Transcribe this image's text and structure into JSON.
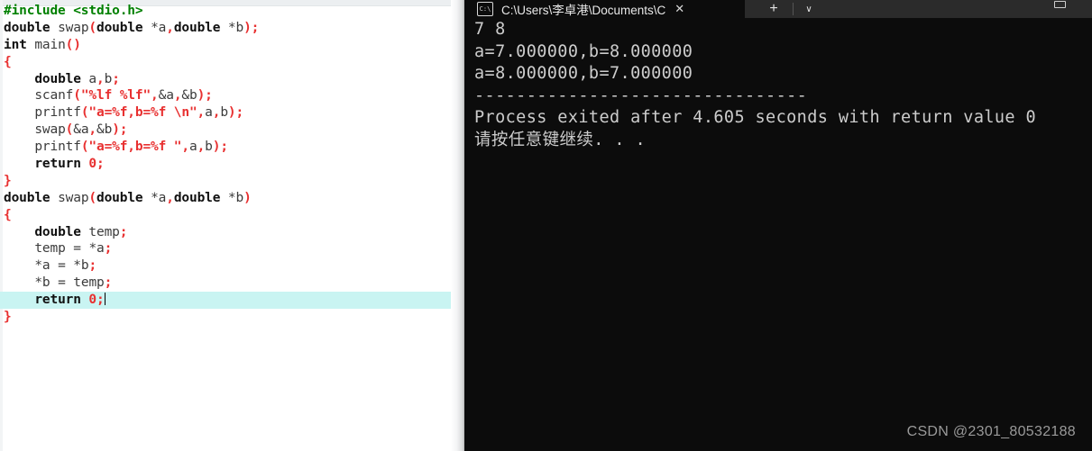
{
  "editor": {
    "name": "code-editor",
    "language": "C",
    "background_color": "#ffffff",
    "highlight_color": "#c9f4f2",
    "highlighted_line_index": 17,
    "lines": [
      {
        "indent": 0,
        "tokens": [
          {
            "t": "pre",
            "s": "#include <stdio.h>"
          }
        ]
      },
      {
        "indent": 0,
        "tokens": [
          {
            "t": "kw",
            "s": "double"
          },
          {
            "t": "plain",
            "s": " "
          },
          {
            "t": "id",
            "s": "swap"
          },
          {
            "t": "punct",
            "s": "("
          },
          {
            "t": "kw",
            "s": "double"
          },
          {
            "t": "plain",
            "s": " "
          },
          {
            "t": "op",
            "s": "*a"
          },
          {
            "t": "punct",
            "s": ","
          },
          {
            "t": "kw",
            "s": "double"
          },
          {
            "t": "plain",
            "s": " "
          },
          {
            "t": "op",
            "s": "*b"
          },
          {
            "t": "punct",
            "s": ");"
          }
        ]
      },
      {
        "indent": 0,
        "tokens": [
          {
            "t": "kw",
            "s": "int"
          },
          {
            "t": "plain",
            "s": " "
          },
          {
            "t": "id",
            "s": "main"
          },
          {
            "t": "punct",
            "s": "()"
          }
        ]
      },
      {
        "indent": 0,
        "tokens": [
          {
            "t": "brace",
            "s": "{"
          }
        ]
      },
      {
        "indent": 1,
        "tokens": [
          {
            "t": "kw",
            "s": "double"
          },
          {
            "t": "plain",
            "s": " "
          },
          {
            "t": "id",
            "s": "a"
          },
          {
            "t": "punct",
            "s": ","
          },
          {
            "t": "id",
            "s": "b"
          },
          {
            "t": "punct",
            "s": ";"
          }
        ]
      },
      {
        "indent": 1,
        "tokens": [
          {
            "t": "id",
            "s": "scanf"
          },
          {
            "t": "punct",
            "s": "("
          },
          {
            "t": "str",
            "s": "\"%lf %lf\""
          },
          {
            "t": "punct",
            "s": ","
          },
          {
            "t": "op",
            "s": "&a"
          },
          {
            "t": "punct",
            "s": ","
          },
          {
            "t": "op",
            "s": "&b"
          },
          {
            "t": "punct",
            "s": ");"
          }
        ]
      },
      {
        "indent": 1,
        "tokens": [
          {
            "t": "id",
            "s": "printf"
          },
          {
            "t": "punct",
            "s": "("
          },
          {
            "t": "str",
            "s": "\"a=%f,b=%f \\n\""
          },
          {
            "t": "punct",
            "s": ","
          },
          {
            "t": "id",
            "s": "a"
          },
          {
            "t": "punct",
            "s": ","
          },
          {
            "t": "id",
            "s": "b"
          },
          {
            "t": "punct",
            "s": ");"
          }
        ]
      },
      {
        "indent": 1,
        "tokens": [
          {
            "t": "id",
            "s": "swap"
          },
          {
            "t": "punct",
            "s": "("
          },
          {
            "t": "op",
            "s": "&a"
          },
          {
            "t": "punct",
            "s": ","
          },
          {
            "t": "op",
            "s": "&b"
          },
          {
            "t": "punct",
            "s": ");"
          }
        ]
      },
      {
        "indent": 1,
        "tokens": [
          {
            "t": "id",
            "s": "printf"
          },
          {
            "t": "punct",
            "s": "("
          },
          {
            "t": "str",
            "s": "\"a=%f,b=%f \""
          },
          {
            "t": "punct",
            "s": ","
          },
          {
            "t": "id",
            "s": "a"
          },
          {
            "t": "punct",
            "s": ","
          },
          {
            "t": "id",
            "s": "b"
          },
          {
            "t": "punct",
            "s": ");"
          }
        ]
      },
      {
        "indent": 1,
        "tokens": [
          {
            "t": "kw",
            "s": "return"
          },
          {
            "t": "plain",
            "s": " "
          },
          {
            "t": "num",
            "s": "0"
          },
          {
            "t": "punct",
            "s": ";"
          }
        ]
      },
      {
        "indent": 0,
        "tokens": [
          {
            "t": "brace",
            "s": "}"
          }
        ]
      },
      {
        "indent": 0,
        "tokens": [
          {
            "t": "kw",
            "s": "double"
          },
          {
            "t": "plain",
            "s": " "
          },
          {
            "t": "id",
            "s": "swap"
          },
          {
            "t": "punct",
            "s": "("
          },
          {
            "t": "kw",
            "s": "double"
          },
          {
            "t": "plain",
            "s": " "
          },
          {
            "t": "op",
            "s": "*a"
          },
          {
            "t": "punct",
            "s": ","
          },
          {
            "t": "kw",
            "s": "double"
          },
          {
            "t": "plain",
            "s": " "
          },
          {
            "t": "op",
            "s": "*b"
          },
          {
            "t": "punct",
            "s": ")"
          }
        ]
      },
      {
        "indent": 0,
        "tokens": [
          {
            "t": "brace",
            "s": "{"
          }
        ]
      },
      {
        "indent": 1,
        "tokens": [
          {
            "t": "kw",
            "s": "double"
          },
          {
            "t": "plain",
            "s": " "
          },
          {
            "t": "id",
            "s": "temp"
          },
          {
            "t": "punct",
            "s": ";"
          }
        ]
      },
      {
        "indent": 1,
        "tokens": [
          {
            "t": "id",
            "s": "temp"
          },
          {
            "t": "plain",
            "s": " "
          },
          {
            "t": "op",
            "s": "="
          },
          {
            "t": "plain",
            "s": " "
          },
          {
            "t": "op",
            "s": "*a"
          },
          {
            "t": "punct",
            "s": ";"
          }
        ]
      },
      {
        "indent": 1,
        "tokens": [
          {
            "t": "op",
            "s": "*a"
          },
          {
            "t": "plain",
            "s": " "
          },
          {
            "t": "op",
            "s": "="
          },
          {
            "t": "plain",
            "s": " "
          },
          {
            "t": "op",
            "s": "*b"
          },
          {
            "t": "punct",
            "s": ";"
          }
        ]
      },
      {
        "indent": 1,
        "tokens": [
          {
            "t": "op",
            "s": "*b"
          },
          {
            "t": "plain",
            "s": " "
          },
          {
            "t": "op",
            "s": "="
          },
          {
            "t": "plain",
            "s": " "
          },
          {
            "t": "id",
            "s": "temp"
          },
          {
            "t": "punct",
            "s": ";"
          }
        ]
      },
      {
        "indent": 1,
        "tokens": [
          {
            "t": "kw",
            "s": "return"
          },
          {
            "t": "plain",
            "s": " "
          },
          {
            "t": "num",
            "s": "0"
          },
          {
            "t": "punct",
            "s": ";"
          }
        ],
        "caret": true
      },
      {
        "indent": 0,
        "tokens": [
          {
            "t": "brace",
            "s": "}"
          }
        ]
      }
    ]
  },
  "terminal": {
    "name": "windows-console",
    "background_color": "#0c0c0c",
    "text_color": "#cccccc",
    "tab_bar": {
      "active_tab": {
        "icon": "console-cmd-icon",
        "title": "C:\\Users\\李卓港\\Documents\\C",
        "close_label": "✕"
      },
      "new_tab_label": "+",
      "dropdown_label": "∨",
      "minimize_label": "minimize-icon"
    },
    "output_lines": [
      "7 8",
      "a=7.000000,b=8.000000",
      "a=8.000000,b=7.000000",
      "--------------------------------",
      "Process exited after 4.605 seconds with return value 0",
      "请按任意键继续. . ."
    ]
  },
  "watermark": {
    "text": "CSDN @2301_80532188"
  }
}
